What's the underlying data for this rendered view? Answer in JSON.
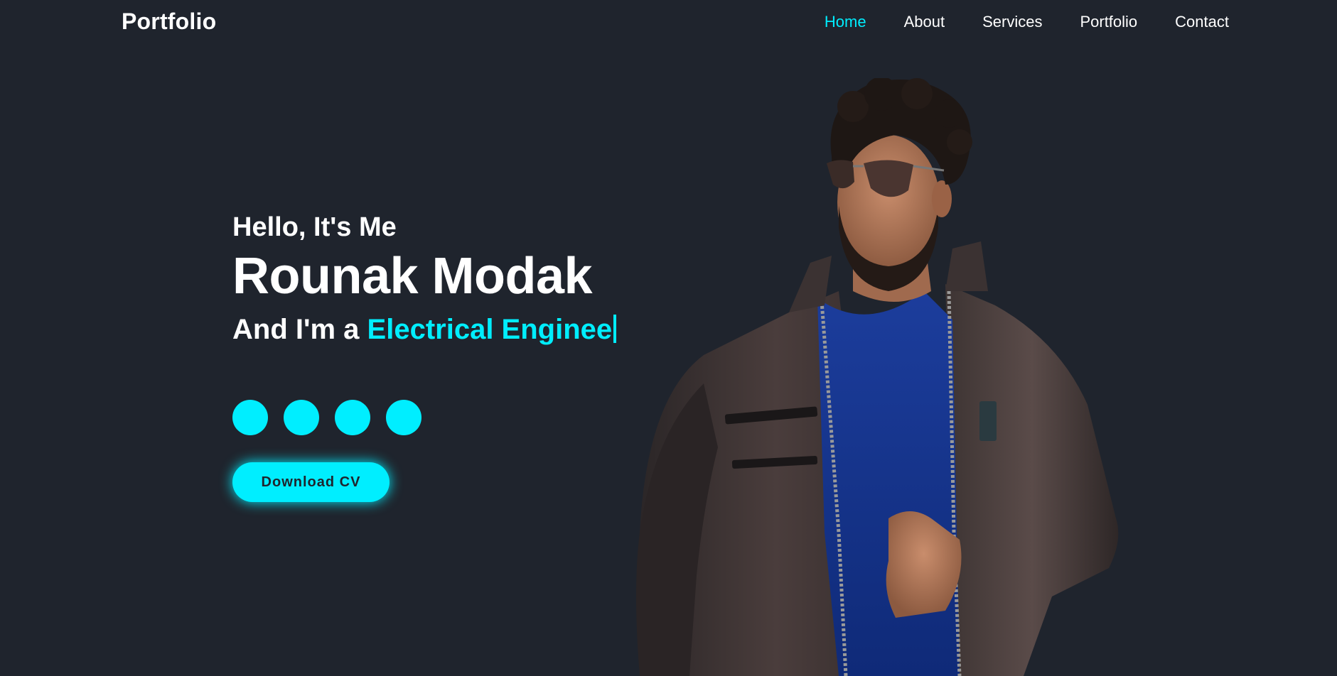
{
  "header": {
    "logo": "Portfolio",
    "nav": [
      {
        "label": "Home",
        "active": true
      },
      {
        "label": "About",
        "active": false
      },
      {
        "label": "Services",
        "active": false
      },
      {
        "label": "Portfolio",
        "active": false
      },
      {
        "label": "Contact",
        "active": false
      }
    ]
  },
  "hero": {
    "greeting": "Hello, It's Me",
    "name": "Rounak Modak",
    "role_prefix": "And I'm a",
    "role_typed": "Electrical Enginee",
    "social_icons": [
      "social-icon-1",
      "social-icon-2",
      "social-icon-3",
      "social-icon-4"
    ],
    "cv_button": "Download CV"
  },
  "colors": {
    "background": "#1f242d",
    "accent": "#00eeff",
    "text": "#ffffff"
  }
}
